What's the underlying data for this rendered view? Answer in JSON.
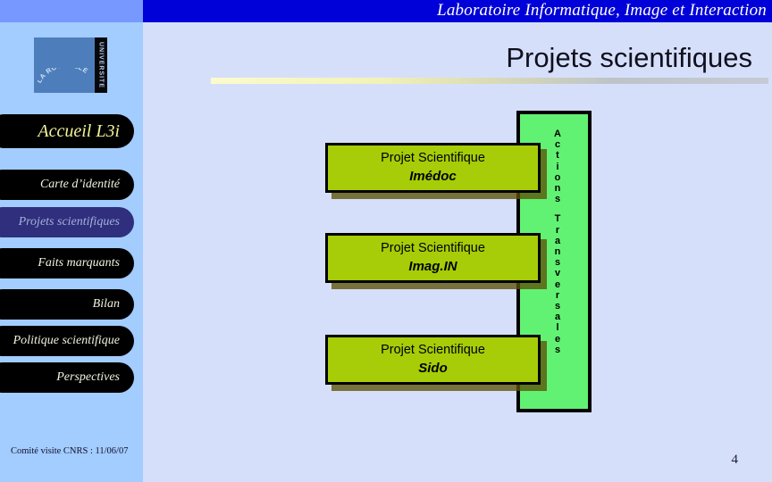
{
  "header": {
    "banner_title": "Laboratoire Informatique, Image et Interaction",
    "page_title": "Projets scientifiques"
  },
  "logo": {
    "arc_text": "LA ROCHELLE",
    "vertical_text": "UNIVERSITE"
  },
  "sidebar": {
    "items": [
      {
        "label": "Accueil L3i",
        "active": false,
        "home": true
      },
      {
        "label": "Carte d’identité",
        "active": false,
        "home": false
      },
      {
        "label": "Projets scientifiques",
        "active": true,
        "home": false
      },
      {
        "label": "Faits marquants",
        "active": false,
        "home": false
      },
      {
        "label": "Bilan",
        "active": false,
        "home": false
      },
      {
        "label": "Politique scientifique",
        "active": false,
        "home": false
      },
      {
        "label": "Perspectives",
        "active": false,
        "home": false
      }
    ],
    "footer_note": "Comité visite CNRS : 11/06/07"
  },
  "main": {
    "vertical_band_label_line1": "Actions",
    "vertical_band_label_line2": "Transversales",
    "projects": [
      {
        "line1": "Projet Scientifique",
        "line2": "Imédoc"
      },
      {
        "line1": "Projet Scientifique",
        "line2": "Imag.IN"
      },
      {
        "line1": "Projet Scientifique",
        "line2": "Sido"
      }
    ]
  },
  "footer": {
    "page_number": "4"
  },
  "colors": {
    "banner_blue": "#0000d8",
    "sidebar_blue": "#a3ccff",
    "sidebar_top_blue": "#7799ff",
    "content_bg": "#d6dffa",
    "pill_black": "#000000",
    "pill_active": "#2f2f7e",
    "box_olive": "#a6cd07",
    "band_green": "#62f273",
    "home_text_yellow": "#f2f29a"
  }
}
